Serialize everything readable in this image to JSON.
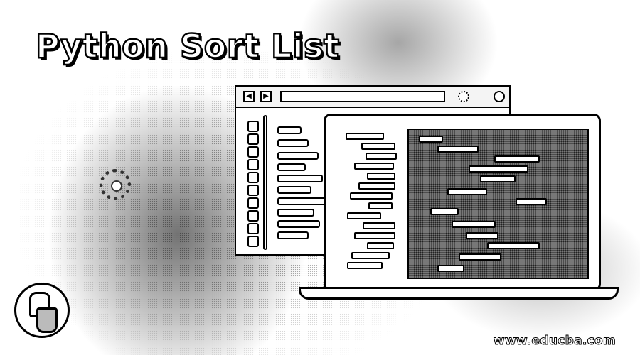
{
  "title": "Python Sort List",
  "watermark": "www.educba.com",
  "browser": {
    "back_icon": "chevron-left-icon",
    "forward_icon": "chevron-right-icon",
    "back_glyph": "◀",
    "forward_glyph": "▶"
  },
  "logo": "python-logo-icon"
}
